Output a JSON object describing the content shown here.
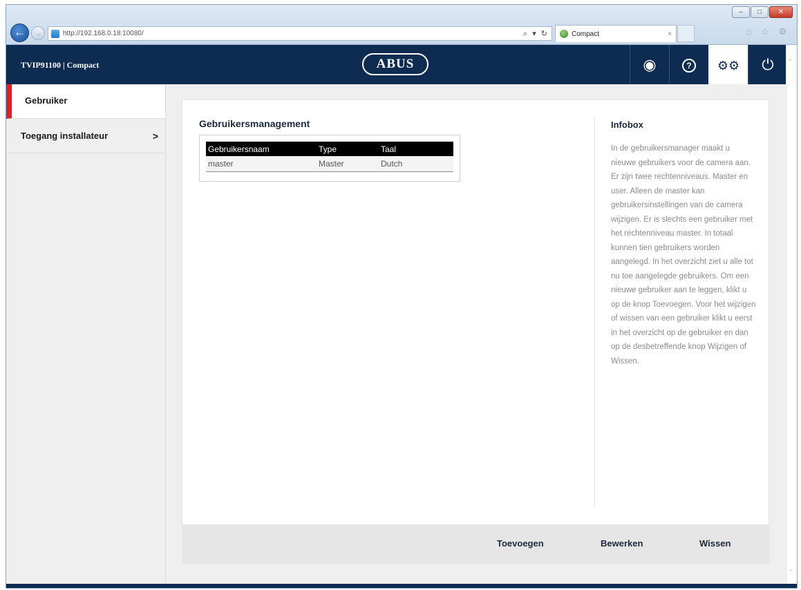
{
  "browser": {
    "url": "http://192.168.0.18:10080/",
    "search_tools": "⌕ ▾ ↻",
    "tab_title": "Compact",
    "tab_close": "×",
    "window_controls": [
      "–",
      "□",
      "✕"
    ],
    "toolbar_icons": "⌂ ☆ ⚙"
  },
  "header": {
    "device_title": "TVIP91100 | Compact",
    "logo": "ABUS",
    "nav": [
      {
        "name": "camera-view",
        "icon": "◉"
      },
      {
        "name": "help",
        "icon": "?"
      },
      {
        "name": "settings",
        "icon": "⚙⚙"
      },
      {
        "name": "power",
        "icon": "⏻"
      }
    ]
  },
  "sidebar": {
    "items": [
      {
        "label": "Gebruiker",
        "active": true
      },
      {
        "label": "Toegang installateur",
        "chevron": ">"
      }
    ]
  },
  "main": {
    "title": "Gebruikersmanagement",
    "table": {
      "headers": [
        "Gebruikersnaam",
        "Type",
        "Taal"
      ],
      "rows": [
        [
          "master",
          "Master",
          "Dutch"
        ]
      ]
    },
    "infobox": {
      "title": "Infobox",
      "text": "In de gebruikersmanager maakt u nieuwe gebruikers voor de camera aan. Er zijn twee rechtenniveaus. Master en user. Alleen de master kan gebruikersinstellingen van de camera wijzigen. Er is slechts een gebruiker met het rechtenniveau master. In totaal kunnen tien gebruikers worden aangelegd. In het overzicht ziet u alle tot nu toe aangelegde gebruikers. Om een nieuwe gebruiker aan te leggen, klikt u op de knop Toevoegen. Voor het wijzigen of wissen van een gebruiker klikt u eerst in het overzicht op de gebruiker en dan op de desbetreffende knop Wijzigen of Wissen."
    },
    "actions": {
      "add": "Toevoegen",
      "edit": "Bewerken",
      "delete": "Wissen"
    }
  },
  "colors": {
    "header_bg": "#0e2b52",
    "active_accent": "#d8232a",
    "sidebar_bg": "#efefef"
  }
}
